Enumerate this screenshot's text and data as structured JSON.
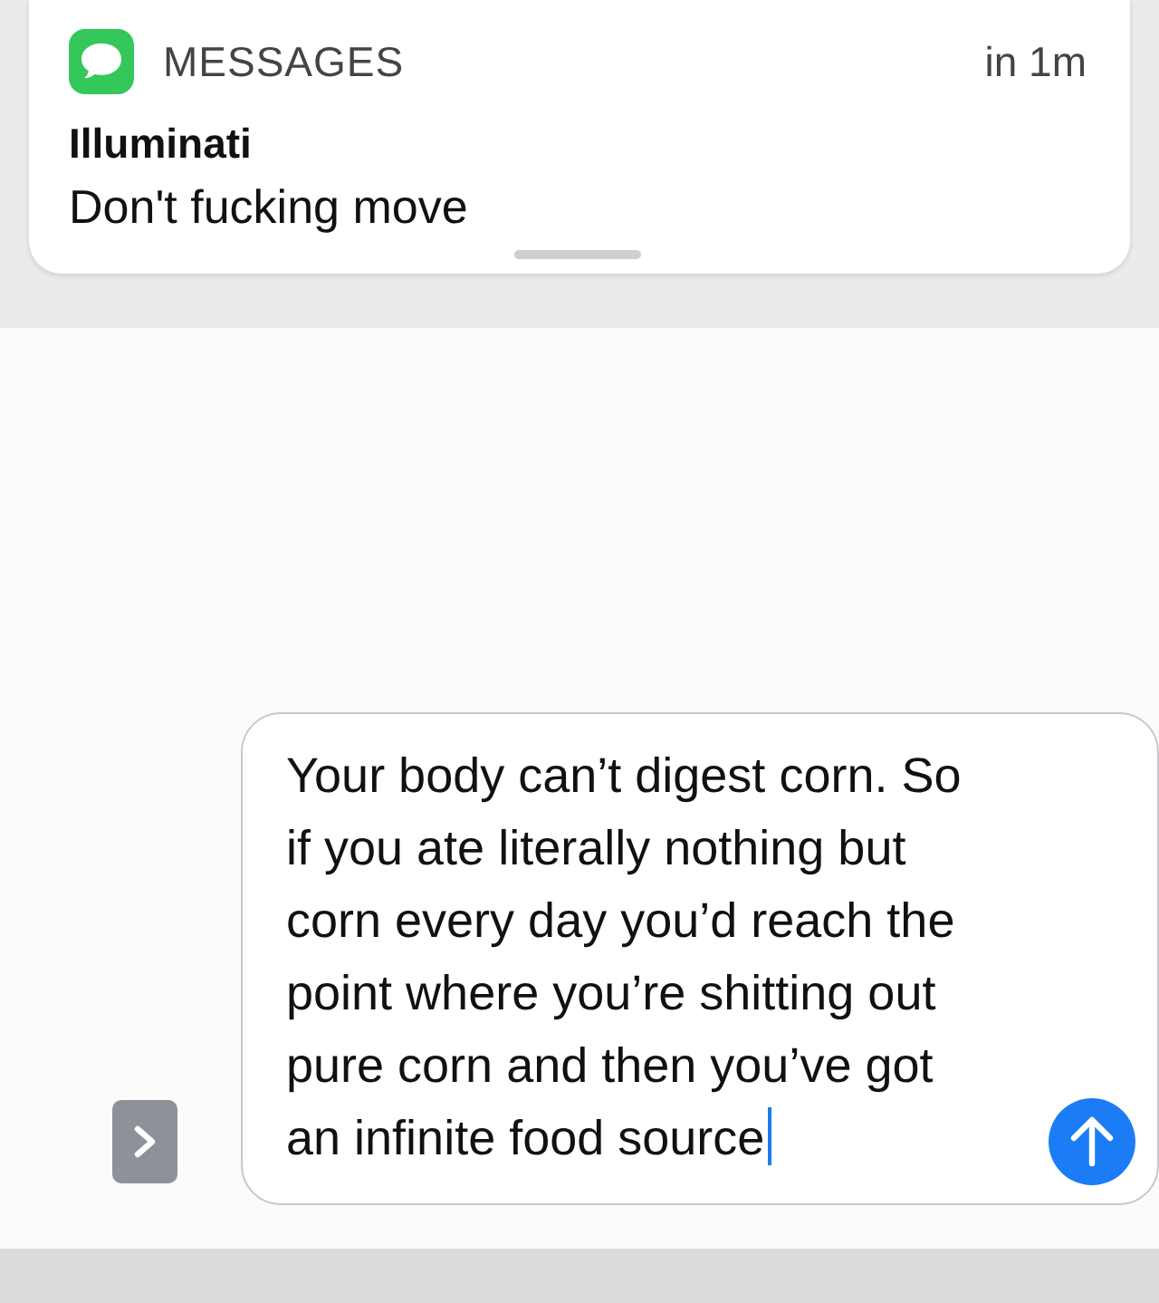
{
  "notification": {
    "app": "MESSAGES",
    "time": "in 1m",
    "sender": "Illuminati",
    "message": "Don't fucking move"
  },
  "composer": {
    "value": "Your body can’t digest corn. So if you ate literally nothing but corn every day you’d reach the point where you’re shitting out pure corn and then you’ve got an infinite food source"
  }
}
